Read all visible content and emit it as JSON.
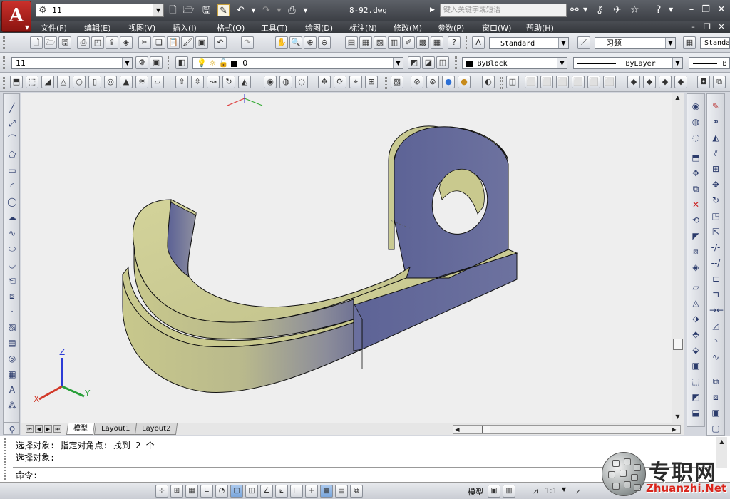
{
  "app": {
    "logo_letter": "A",
    "workspace": "11",
    "doc_title": "8-92.dwg",
    "search_placeholder": "键入关键字或短语"
  },
  "menu": [
    "文件(F)",
    "编辑(E)",
    "视图(V)",
    "插入(I)",
    "格式(O)",
    "工具(T)",
    "绘图(D)",
    "标注(N)",
    "修改(M)",
    "参数(P)",
    "窗口(W)",
    "帮助(H)"
  ],
  "styles": {
    "text_style": "Standard",
    "dim_style": "习题",
    "table_style": "Standa"
  },
  "layers": {
    "workspace_combo": "11",
    "layer_name": "0",
    "color": "ByBlock",
    "linetype": "ByLayer",
    "lineweight_partial": "B"
  },
  "ucs_icon": {
    "x_label": "X",
    "y_label": "Y",
    "z_label": "Z"
  },
  "tabs": {
    "model": "模型",
    "layout1": "Layout1",
    "layout2": "Layout2"
  },
  "command": {
    "history": [
      "选择对象: 指定对角点: 找到 2 个",
      "选择对象:"
    ],
    "prompt": "命令:"
  },
  "statusbar": {
    "space": "模型",
    "scale": "1:1"
  },
  "watermark": {
    "cn": "专职网",
    "url": "Zhuanzhi.Net"
  },
  "colors": {
    "solid_light": "#c9c98e",
    "solid_blue": "#6a6f9e",
    "canvas_bg": "#eeeeee",
    "titlebar": "#3b3e44"
  }
}
